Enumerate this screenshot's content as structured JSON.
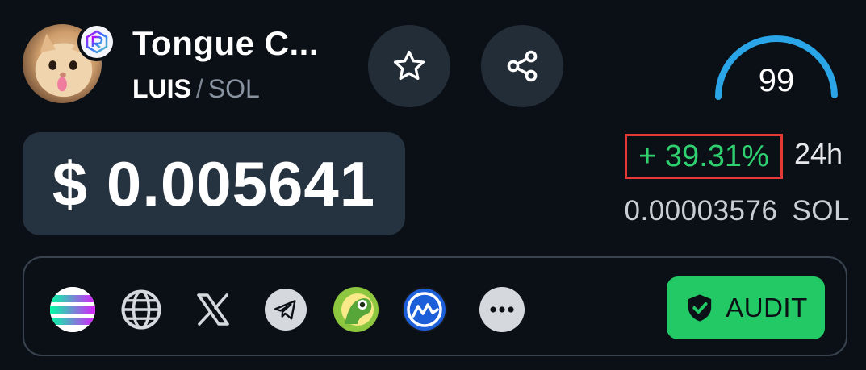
{
  "token": {
    "name": "Tongue C...",
    "base_symbol": "LUIS",
    "separator": "/",
    "quote_symbol": "SOL",
    "avatar_icon": "cat-avatar",
    "dex_badge": "raydium-icon"
  },
  "actions": {
    "favorite_icon": "star-icon",
    "share_icon": "share-icon"
  },
  "score": {
    "value": "99",
    "level": 0.99,
    "color": "#2aa6e8"
  },
  "price": {
    "usd": "$ 0.005641",
    "change": "+ 39.31%",
    "change_period": "24h",
    "native_value": "0.00003576",
    "native_unit": "SOL",
    "change_color": "#2fd06f"
  },
  "links": [
    {
      "name": "solana-icon"
    },
    {
      "name": "globe-icon"
    },
    {
      "name": "x-icon"
    },
    {
      "name": "telegram-icon"
    },
    {
      "name": "coingecko-icon"
    },
    {
      "name": "coinmarketcap-icon"
    },
    {
      "name": "more-icon"
    }
  ],
  "audit": {
    "label": "AUDIT",
    "icon": "shield-check-icon",
    "color": "#22c964"
  }
}
